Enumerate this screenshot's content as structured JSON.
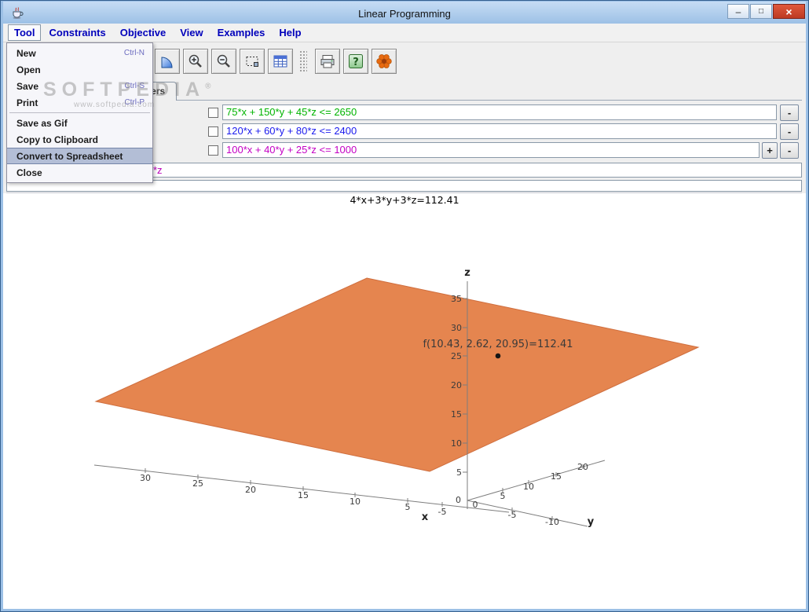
{
  "window": {
    "title": "Linear Programming",
    "controls": {
      "minimize": "–",
      "maximize": "□",
      "close": "×"
    }
  },
  "menubar": {
    "selected": "Tool",
    "items": [
      {
        "label": "Tool"
      },
      {
        "label": "Constraints"
      },
      {
        "label": "Objective"
      },
      {
        "label": "View"
      },
      {
        "label": "Examples"
      },
      {
        "label": "Help"
      }
    ]
  },
  "tool_menu": {
    "items": [
      {
        "label": "New",
        "shortcut": "Ctrl-N"
      },
      {
        "label": "Open",
        "shortcut": ""
      },
      {
        "label": "Save",
        "shortcut": "Ctrl-S"
      },
      {
        "label": "Print",
        "shortcut": "Ctrl-P"
      },
      {
        "label": "Save as Gif",
        "shortcut": ""
      },
      {
        "label": "Copy to Clipboard",
        "shortcut": ""
      },
      {
        "label": "Convert to Spreadsheet",
        "shortcut": "",
        "highlighted": true
      },
      {
        "label": "Close",
        "shortcut": ""
      }
    ]
  },
  "toolbar": {
    "buttons": [
      "quarter-disc",
      "zoom-in",
      "zoom-out",
      "zoom-region",
      "spreadsheet",
      "print",
      "help",
      "flower"
    ]
  },
  "tabs": {
    "active": "Parameters"
  },
  "constraints": {
    "rows": [
      {
        "expression": "75*x + 150*y + 45*z <= 2650",
        "color": "#00b400",
        "checked": false,
        "buttons": [
          "-"
        ]
      },
      {
        "expression": "120*x + 60*y + 80*z <= 2400",
        "color": "#1a1aee",
        "checked": false,
        "buttons": [
          "-"
        ]
      },
      {
        "expression": "100*x + 40*y + 25*z <= 1000",
        "color": "#c400c4",
        "checked": false,
        "buttons": [
          "+",
          "-"
        ]
      }
    ]
  },
  "objective": {
    "expression": "4*x+3*y+3*z",
    "color": "#bb00bb"
  },
  "status_field": {
    "value": ""
  },
  "watermark": {
    "brand": "SOFTPEDIA",
    "reg": "®",
    "url": "www.softpedia.com"
  },
  "chart_data": {
    "type": "scatter",
    "title": "4*x+3*y+3*z=112.41",
    "annotation": "f(10.43, 2.62, 20.95)=112.41",
    "optimum_point": {
      "x": 10.43,
      "y": 2.62,
      "z": 20.95,
      "value": 112.41
    },
    "plane": {
      "color": "#e5854f",
      "edge_color": "#cf6e3e",
      "equation": "4*x+3*y+3*z=112.41"
    },
    "axes": {
      "x": {
        "label": "x",
        "ticks": [
          "-5",
          "5",
          "10",
          "15",
          "20",
          "25",
          "30"
        ]
      },
      "y": {
        "label": "y",
        "ticks_positive": [
          "5",
          "10",
          "15",
          "20"
        ],
        "ticks_negative": [
          "-5",
          "-10"
        ]
      },
      "z": {
        "label": "z",
        "ticks": [
          "5",
          "10",
          "15",
          "20",
          "25",
          "30",
          "35"
        ]
      },
      "origin": {
        "left": "0",
        "right": "0"
      }
    }
  }
}
